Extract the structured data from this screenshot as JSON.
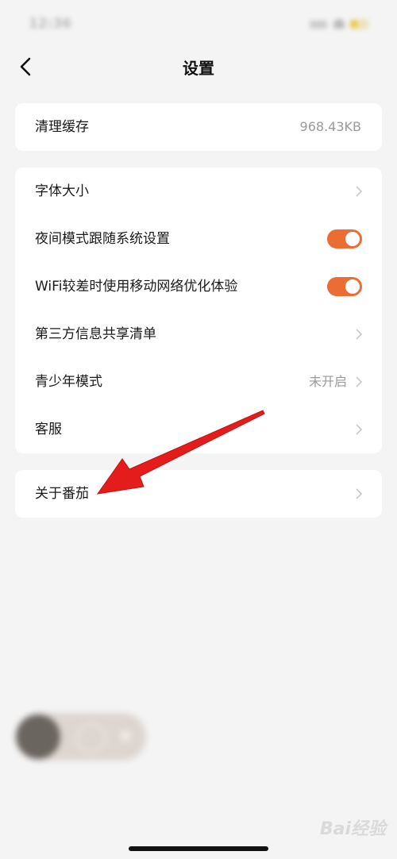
{
  "status": {
    "time": "12:36"
  },
  "header": {
    "title": "设置"
  },
  "cache": {
    "label": "清理缓存",
    "value": "968.43KB"
  },
  "settings": {
    "font_size": {
      "label": "字体大小"
    },
    "night_mode": {
      "label": "夜间模式跟随系统设置",
      "enabled": true
    },
    "wifi_optimize": {
      "label": "WiFi较差时使用移动网络优化体验",
      "enabled": true
    },
    "third_party": {
      "label": "第三方信息共享清单"
    },
    "teen_mode": {
      "label": "青少年模式",
      "value": "未开启"
    },
    "support": {
      "label": "客服"
    }
  },
  "about": {
    "label": "关于番茄"
  },
  "watermark": {
    "text": "Bai经验"
  },
  "colors": {
    "accent": "#ec6d33",
    "arrow": "#e51c1c",
    "background": "#f4f4f4"
  }
}
